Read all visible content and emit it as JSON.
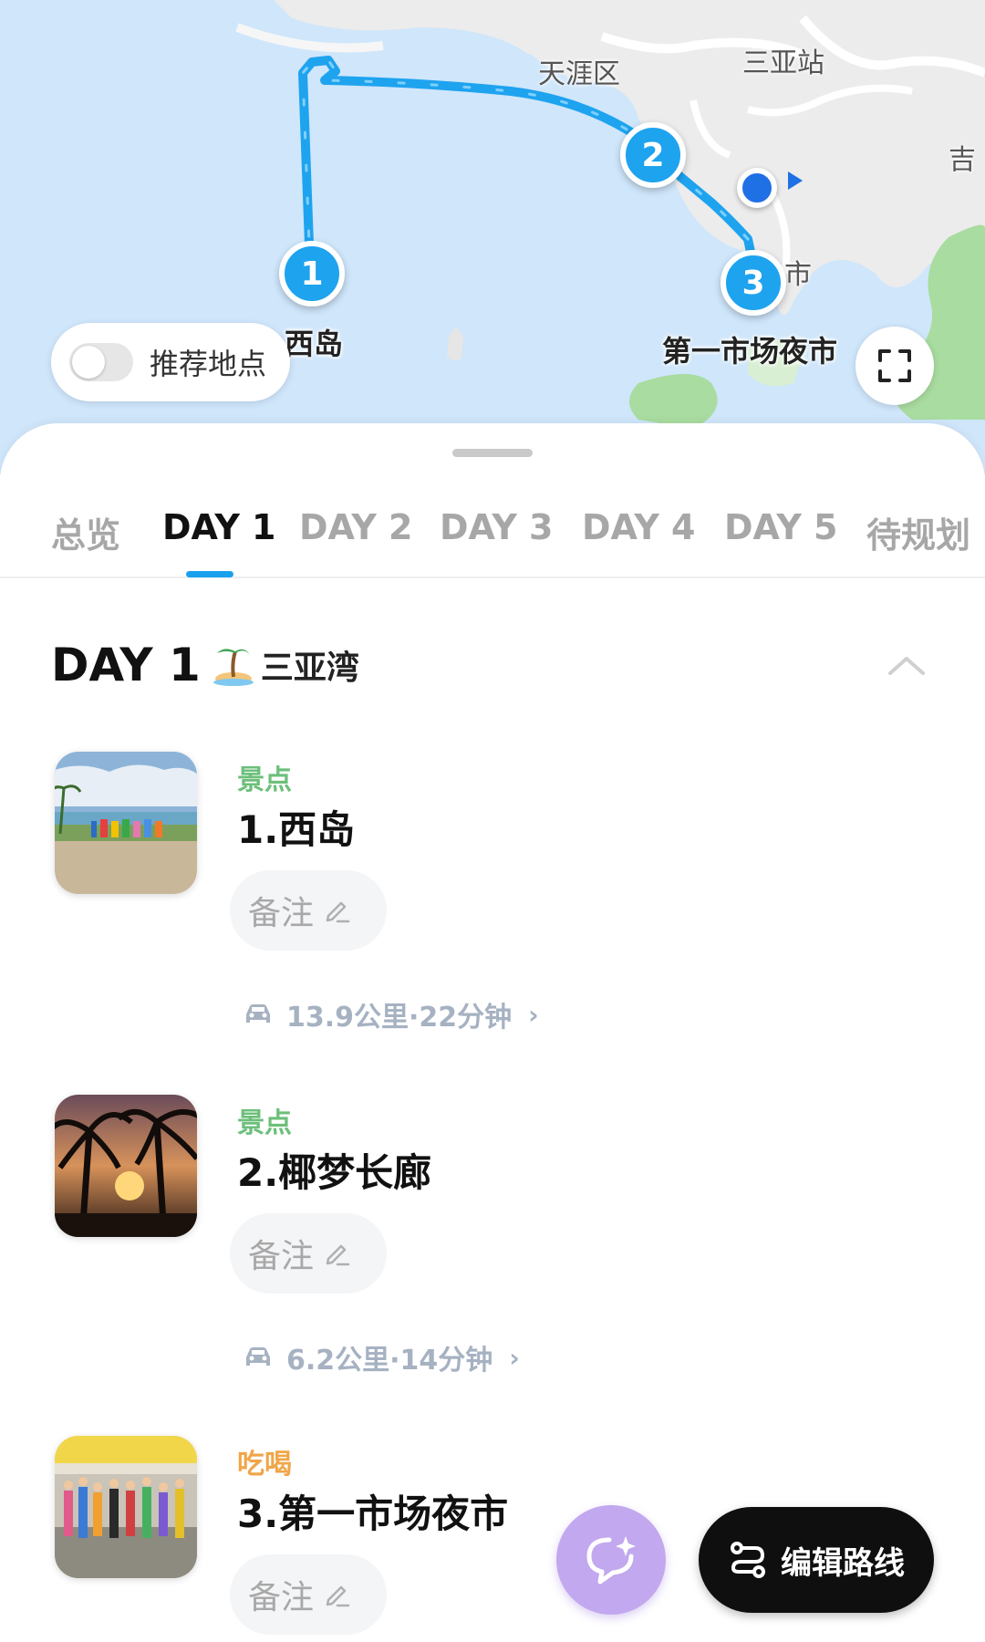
{
  "map": {
    "labels": {
      "tianya": "天涯区",
      "sanya_station": "三亚站",
      "ji": "吉",
      "shi": "市"
    },
    "pins": [
      {
        "number": "1",
        "label": "西岛"
      },
      {
        "number": "2",
        "label": ""
      },
      {
        "number": "3",
        "label": "第一市场夜市"
      }
    ],
    "recommend_toggle": {
      "label": "推荐地点",
      "on": false
    },
    "route_color": "#1ea3ef"
  },
  "tabs": [
    "总览",
    "DAY 1",
    "DAY 2",
    "DAY 3",
    "DAY 4",
    "DAY 5",
    "待规划"
  ],
  "active_tab": "DAY 1",
  "day": {
    "title": "DAY 1",
    "emoji": "🏝",
    "area": "三亚湾"
  },
  "pois": [
    {
      "category": "景点",
      "name": "1.西岛",
      "note_label": "备注"
    },
    {
      "category": "景点",
      "name": "2.椰梦长廊",
      "note_label": "备注"
    },
    {
      "category": "吃喝",
      "name": "3.第一市场夜市",
      "note_label": "备注"
    }
  ],
  "routes": [
    {
      "text": "13.9公里·22分钟"
    },
    {
      "text": "6.2公里·14分钟"
    }
  ],
  "actions": {
    "edit_route": "编辑路线"
  },
  "colors": {
    "accent": "#1aa1ee",
    "sight": "#6cbf7a",
    "food": "#f0a648",
    "ai_button": "#c2a8ee"
  }
}
